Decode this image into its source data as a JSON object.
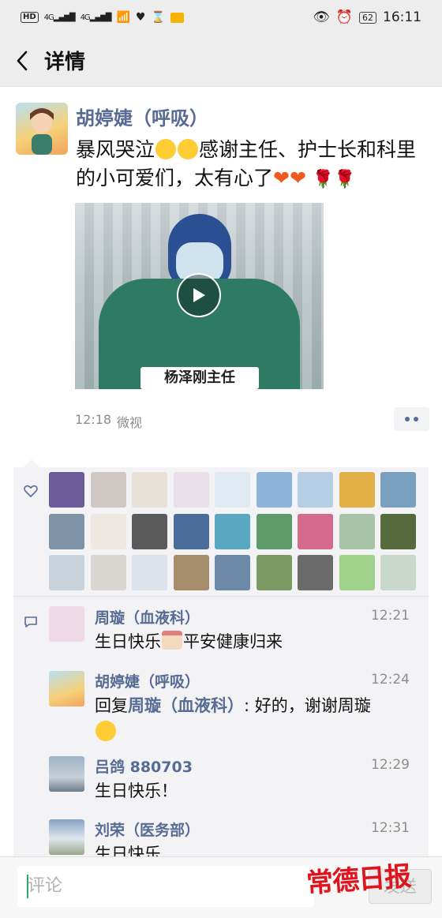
{
  "status_bar": {
    "left_chips": [
      "HD",
      "4G",
      "4G"
    ],
    "battery": "62",
    "time": "16:11"
  },
  "header": {
    "title": "详情",
    "back_icon": "chevron-left-icon"
  },
  "post": {
    "author": "胡婷婕（呼吸）",
    "text_segments": {
      "a": "暴风哭泣",
      "b": "感谢主任、护士长和科里的小可爱们，太有心了",
      "hearts": "❤❤",
      "roses": "🌹🌹"
    },
    "video_caption": "杨泽刚主任",
    "time": "12:18",
    "source": "微视"
  },
  "likes": {
    "icon": "heart-outline-icon",
    "avatar_colors": [
      "#6b5b9a",
      "#cfc7c4",
      "#e8e1d8",
      "#e9dfe8",
      "#dfe9f2",
      "#8bb3d9",
      "#b6cde6",
      "#e2b046",
      "#7aa0c0",
      "#7f93a6",
      "#ede8e1",
      "#5b5b5b",
      "#4a6d9c",
      "#5aa7c2",
      "#5f9b6a",
      "#d56a8f",
      "#a9c3a8",
      "#556b3e",
      "#c8d3de",
      "#d9d5d0",
      "#dce3ea",
      "#a58c6a",
      "#6c8aa8",
      "#7c9a64",
      "#6b6b6b",
      "#9fd18a",
      "#c9d8cc"
    ]
  },
  "comments": {
    "icon": "comment-icon",
    "items": [
      {
        "name": "周璇（血液科）",
        "time": "12:21",
        "text_a": "生日快乐",
        "text_b": "平安健康归来",
        "avatar_color": "#efd9e6"
      },
      {
        "name": "胡婷婕（呼吸）",
        "time": "12:24",
        "reply_prefix": "回复",
        "reply_target": "周璇（血液科）",
        "text": ": 好的，谢谢周璇",
        "avatar_color": "#f2c779"
      },
      {
        "name": "吕鸽 880703",
        "time": "12:29",
        "text": "生日快乐！",
        "avatar_color": "#8e9db0"
      },
      {
        "name": "刘荣（医务部）",
        "time": "12:31",
        "text": "生日快乐",
        "avatar_color": "#8aa4c6"
      }
    ]
  },
  "comment_box": {
    "placeholder": "评论",
    "send_label": "发送"
  },
  "watermark": "常德日报"
}
